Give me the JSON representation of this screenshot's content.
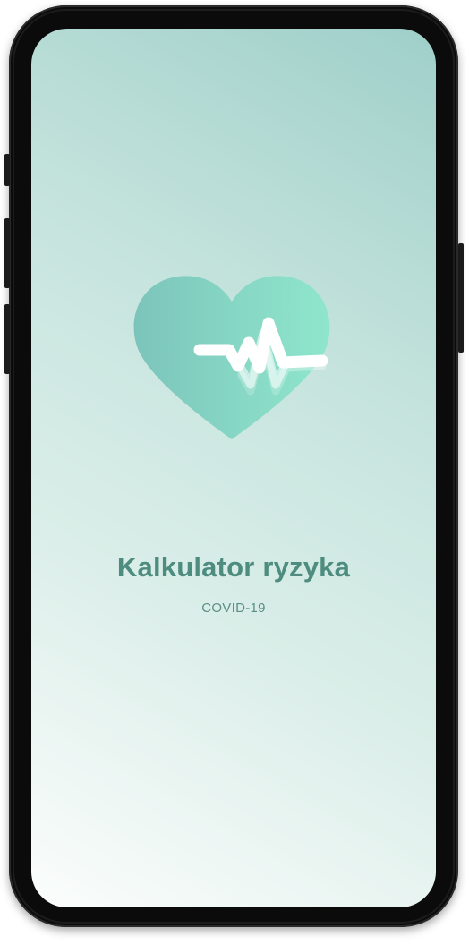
{
  "splash": {
    "title": "Kalkulator ryzyka",
    "subtitle": "COVID-19",
    "logo_icon": "heart-pulse-icon"
  },
  "colors": {
    "title": "#4d8c7f",
    "subtitle": "#5a8f84",
    "background_light": "#fbfdfc",
    "background_dark": "#9fcfc9",
    "heart_left": "#79c6bc",
    "heart_right": "#8be3c9",
    "pulse_line": "#ffffff"
  }
}
